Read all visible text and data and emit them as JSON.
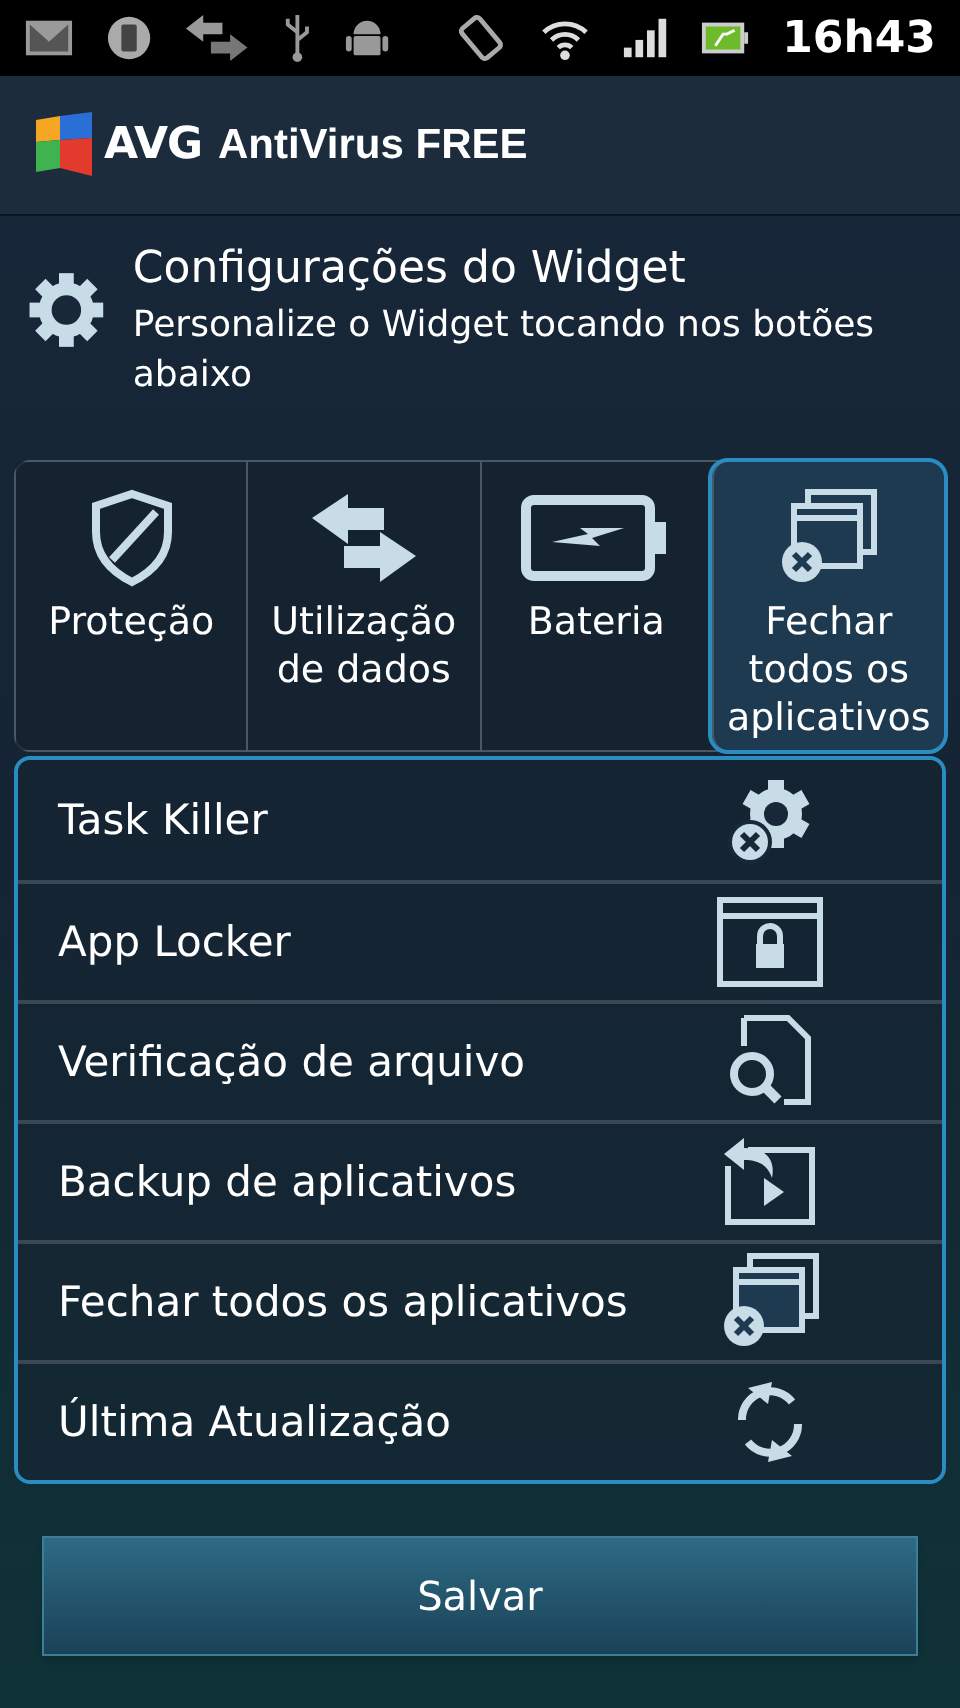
{
  "status_bar": {
    "time": "16h43"
  },
  "app_header": {
    "brand": "AVG",
    "product": "AntiVirus FREE"
  },
  "section": {
    "title": "Configurações do Widget",
    "subtitle": "Personalize o Widget tocando nos botões abaixo"
  },
  "tabs": [
    {
      "label": "Proteção",
      "selected": false
    },
    {
      "label": "Utilização de dados",
      "selected": false
    },
    {
      "label": "Bateria",
      "selected": false
    },
    {
      "label": "Fechar todos os aplicativos",
      "selected": true
    }
  ],
  "options": [
    {
      "label": "Task Killer"
    },
    {
      "label": "App Locker"
    },
    {
      "label": "Verificação de arquivo"
    },
    {
      "label": "Backup de aplicativos"
    },
    {
      "label": "Fechar todos os aplicativos"
    },
    {
      "label": "Última Atualização"
    }
  ],
  "buttons": [
    {
      "label": "Salvar"
    }
  ]
}
